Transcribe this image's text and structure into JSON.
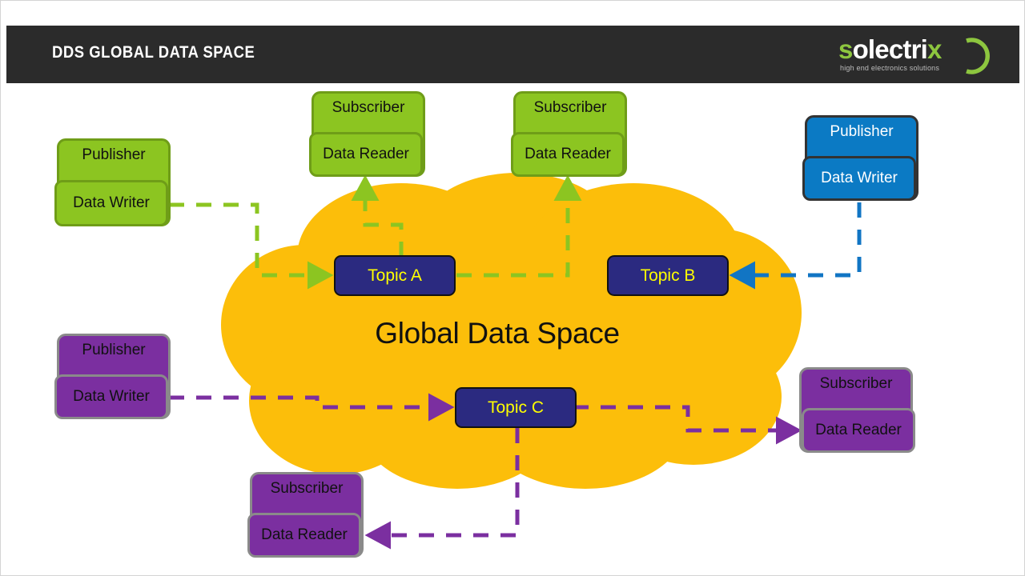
{
  "header": {
    "title": "DDS GLOBAL DATA SPACE",
    "logo": {
      "word_s": "s",
      "word_mid": "olectri",
      "word_x": "x",
      "tagline": "high end electronics solutions"
    }
  },
  "cloud": {
    "label": "Global Data Space"
  },
  "topics": [
    {
      "id": "topic-a",
      "label": "Topic A"
    },
    {
      "id": "topic-b",
      "label": "Topic B"
    },
    {
      "id": "topic-c",
      "label": "Topic C"
    }
  ],
  "nodes": [
    {
      "id": "publisher-green",
      "role": "Publisher",
      "endpoint": "Data Writer",
      "color": "green"
    },
    {
      "id": "subscriber-green-1",
      "role": "Subscriber",
      "endpoint": "Data Reader",
      "color": "green"
    },
    {
      "id": "subscriber-green-2",
      "role": "Subscriber",
      "endpoint": "Data Reader",
      "color": "green"
    },
    {
      "id": "publisher-blue",
      "role": "Publisher",
      "endpoint": "Data Writer",
      "color": "blue"
    },
    {
      "id": "publisher-purple",
      "role": "Publisher",
      "endpoint": "Data Writer",
      "color": "purple"
    },
    {
      "id": "subscriber-purple-1",
      "role": "Subscriber",
      "endpoint": "Data Reader",
      "color": "purple"
    },
    {
      "id": "subscriber-purple-2",
      "role": "Subscriber",
      "endpoint": "Data Reader",
      "color": "purple"
    }
  ],
  "colors": {
    "header_bg": "#2b2b2b",
    "logo_green": "#8dc63f",
    "cloud": "#fcbe0a",
    "topic_fill": "#2b2a80",
    "topic_text": "#ffff00",
    "green": "#8cc521",
    "green_border": "#6f9d18",
    "blue": "#0b7ac4",
    "purple": "#7b2fa0",
    "purple_border": "#8a8a8a",
    "wire_green": "#8cc521",
    "wire_blue": "#1175c4",
    "wire_purple": "#7b2fa0"
  },
  "flows": [
    {
      "id": "flow-green-write-a",
      "from": "publisher-green",
      "to": "topic-a",
      "color": "green"
    },
    {
      "id": "flow-green-read-a-1",
      "from": "topic-a",
      "to": "subscriber-green-1",
      "color": "green"
    },
    {
      "id": "flow-green-read-a-2",
      "from": "topic-a",
      "to": "subscriber-green-2",
      "color": "green"
    },
    {
      "id": "flow-blue-write-b",
      "from": "publisher-blue",
      "to": "topic-b",
      "color": "blue"
    },
    {
      "id": "flow-purple-write-c",
      "from": "publisher-purple",
      "to": "topic-c",
      "color": "purple"
    },
    {
      "id": "flow-purple-read-c-1",
      "from": "topic-c",
      "to": "subscriber-purple-1",
      "color": "purple"
    },
    {
      "id": "flow-purple-read-c-2",
      "from": "topic-c",
      "to": "subscriber-purple-2",
      "color": "purple"
    }
  ]
}
